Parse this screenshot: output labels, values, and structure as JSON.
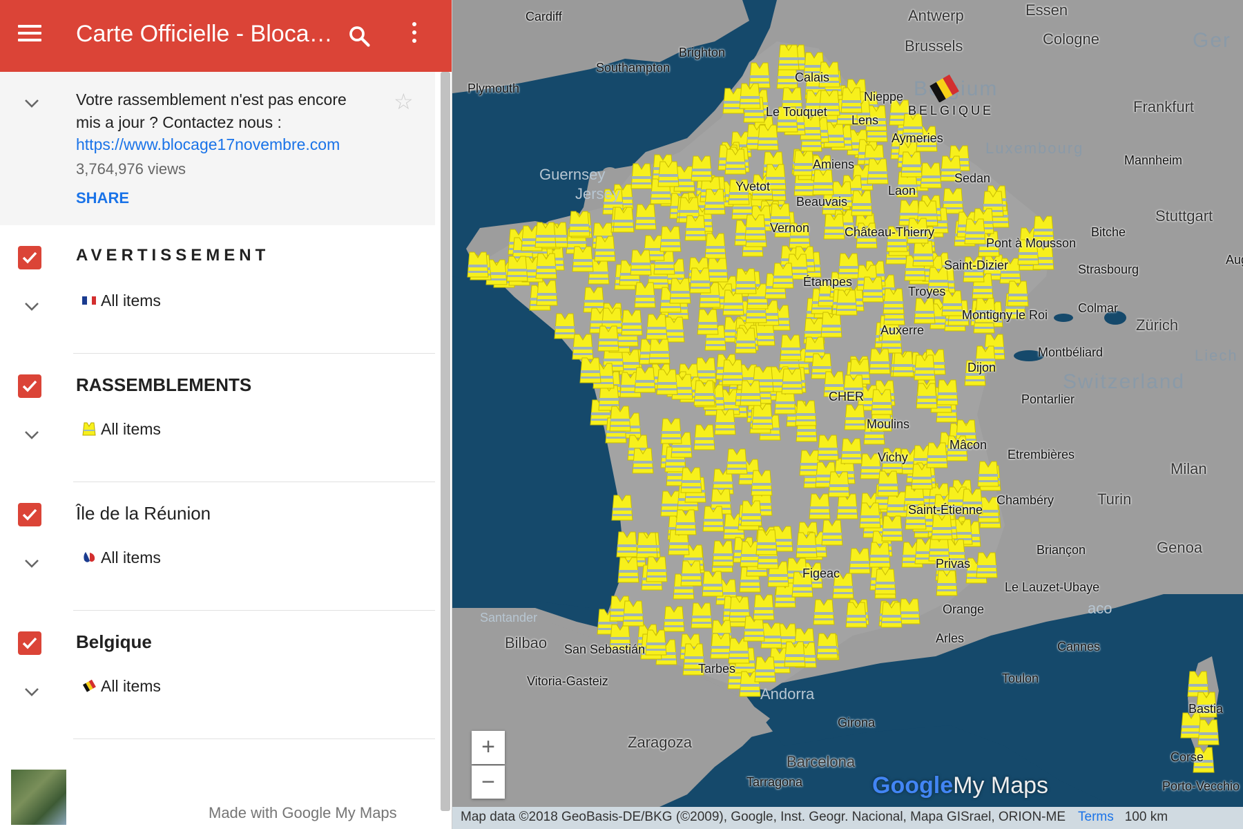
{
  "appbar": {
    "title": "Carte Officielle - Blocag...",
    "menu_icon": "hamburger-menu-icon",
    "search_icon": "search-icon",
    "more_icon": "more-vert-icon",
    "color": "#db4437"
  },
  "info": {
    "description": "Votre rassemblement n'est pas encore mis a jour ? Contactez nous :",
    "link": "https://www.blocage17novembre.com",
    "views": "3,764,976 views",
    "share_label": "SHARE",
    "star_icon": "star-outline-icon"
  },
  "layers": [
    {
      "name": "AVERTISSEMENT",
      "items_label": "All items",
      "icon": "french-flag-icon",
      "checked": true
    },
    {
      "name": "RASSEMBLEMENTS",
      "items_label": "All items",
      "icon": "yellow-vest-icon",
      "checked": true
    },
    {
      "name": "Île de la Réunion",
      "items_label": "All items",
      "icon": "reunion-map-icon",
      "checked": true
    },
    {
      "name": "Belgique",
      "items_label": "All items",
      "icon": "belgian-flag-icon",
      "checked": true
    }
  ],
  "footer": {
    "made_with": "Made with Google My Maps"
  },
  "map": {
    "zoom_in": "+",
    "zoom_out": "−",
    "attribution": "Map data ©2018 GeoBasis-DE/BKG (©2009), Google, Inst. Geogr. Nacional, Mapa GISrael, ORION-ME",
    "terms": "Terms",
    "scale": "100 km",
    "logo": {
      "google": "Google",
      "mymaps": "My Maps"
    },
    "marker_color": "#f7f01c",
    "labels": {
      "cardiff": "Cardiff",
      "antwerp": "Antwerp",
      "essen": "Essen",
      "brussels": "Brussels",
      "cologne": "Cologne",
      "germany": "Ger",
      "southampton": "Southampton",
      "brighton": "Brighton",
      "plymouth": "Plymouth",
      "calais": "Calais",
      "nieppe": "Nieppe",
      "belgium": "Belgium",
      "belgique": "BELGIQUE",
      "frankfurt": "Frankfurt",
      "le_touquet": "Le Touquet",
      "lens": "Lens",
      "aymeries": "Aymeries",
      "luxembourg": "Luxembourg",
      "mannheim": "Mannheim",
      "guernsey": "Guernsey",
      "jersey": "Jersey",
      "amiens": "Amiens",
      "yvetot": "Yvetot",
      "sedan": "Sedan",
      "laon": "Laon",
      "beauvais": "Beauvais",
      "stuttgart": "Stuttgart",
      "vernon": "Vernon",
      "chateau_thierry": "Château-Thierry",
      "bitche": "Bitche",
      "pont_a_mousson": "Pont à Mousson",
      "saint_dizier": "Saint-Dizier",
      "strasbourg": "Strasbourg",
      "etampes": "Étampes",
      "troyes": "Troyes",
      "colmar": "Colmar",
      "montigny": "Montigny le Roi",
      "zurich": "Zürich",
      "auxerre": "Auxerre",
      "montbeliard": "Montbéliard",
      "liech": "Liech",
      "dijon": "Dijon",
      "switzerland": "Switzerland",
      "cher": "CHER",
      "pontarlier": "Pontarlier",
      "moulins": "Moulins",
      "macon": "Mâcon",
      "vichy": "Vichy",
      "etrembieres": "Etrembières",
      "milan": "Milan",
      "chambery": "Chambéry",
      "turin": "Turin",
      "saint_etienne": "Saint-Étienne",
      "briancon": "Briançon",
      "genoa": "Genoa",
      "privas": "Privas",
      "figeac": "Figeac",
      "lauzet": "Le Lauzet-Ubaye",
      "orange": "Orange",
      "santander": "Santander",
      "bilbao": "Bilbao",
      "san_sebastian": "San Sebastián",
      "arles": "Arles",
      "cannes": "Cannes",
      "toulon": "Toulon",
      "tarbes": "Tarbes",
      "vitoria": "Vitoria-Gasteiz",
      "bastia": "Bastia",
      "andorra": "Andorra",
      "girona": "Girona",
      "corse": "Corse",
      "zaragoza": "Zaragoza",
      "barcelona": "Barcelona",
      "tarragona": "Tarragona",
      "porto_vecchio": "Porto-Vecchio",
      "aug": "Aug",
      "aco": "aco"
    }
  }
}
